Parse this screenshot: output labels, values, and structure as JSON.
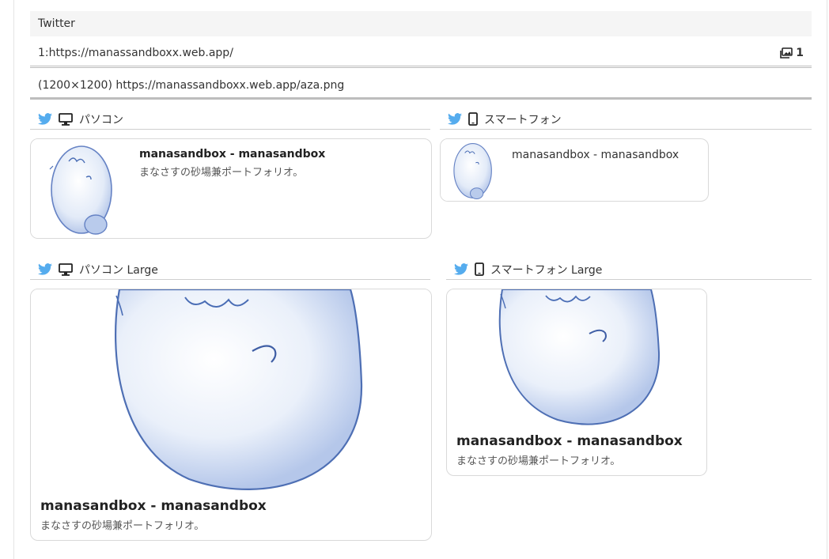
{
  "header": {
    "title": "Twitter"
  },
  "url_row": {
    "url": "1:https://manassandboxx.web.app/",
    "count": "1"
  },
  "image_row": {
    "text": "(1200×1200) https://manassandboxx.web.app/aza.png"
  },
  "sections": {
    "pc": "パソコン",
    "sp": "スマートフォン",
    "pc_large": "パソコン Large",
    "sp_large": "スマートフォン Large"
  },
  "card": {
    "title": "manasandbox - manasandbox",
    "description": "まなさすの砂場兼ポートフォリオ。"
  },
  "colors": {
    "twitter_blue": "#55acee",
    "egg_blue": "#4a6db5"
  },
  "icons": [
    "twitter-bird-icon",
    "desktop-icon",
    "smartphone-icon",
    "images-icon"
  ]
}
